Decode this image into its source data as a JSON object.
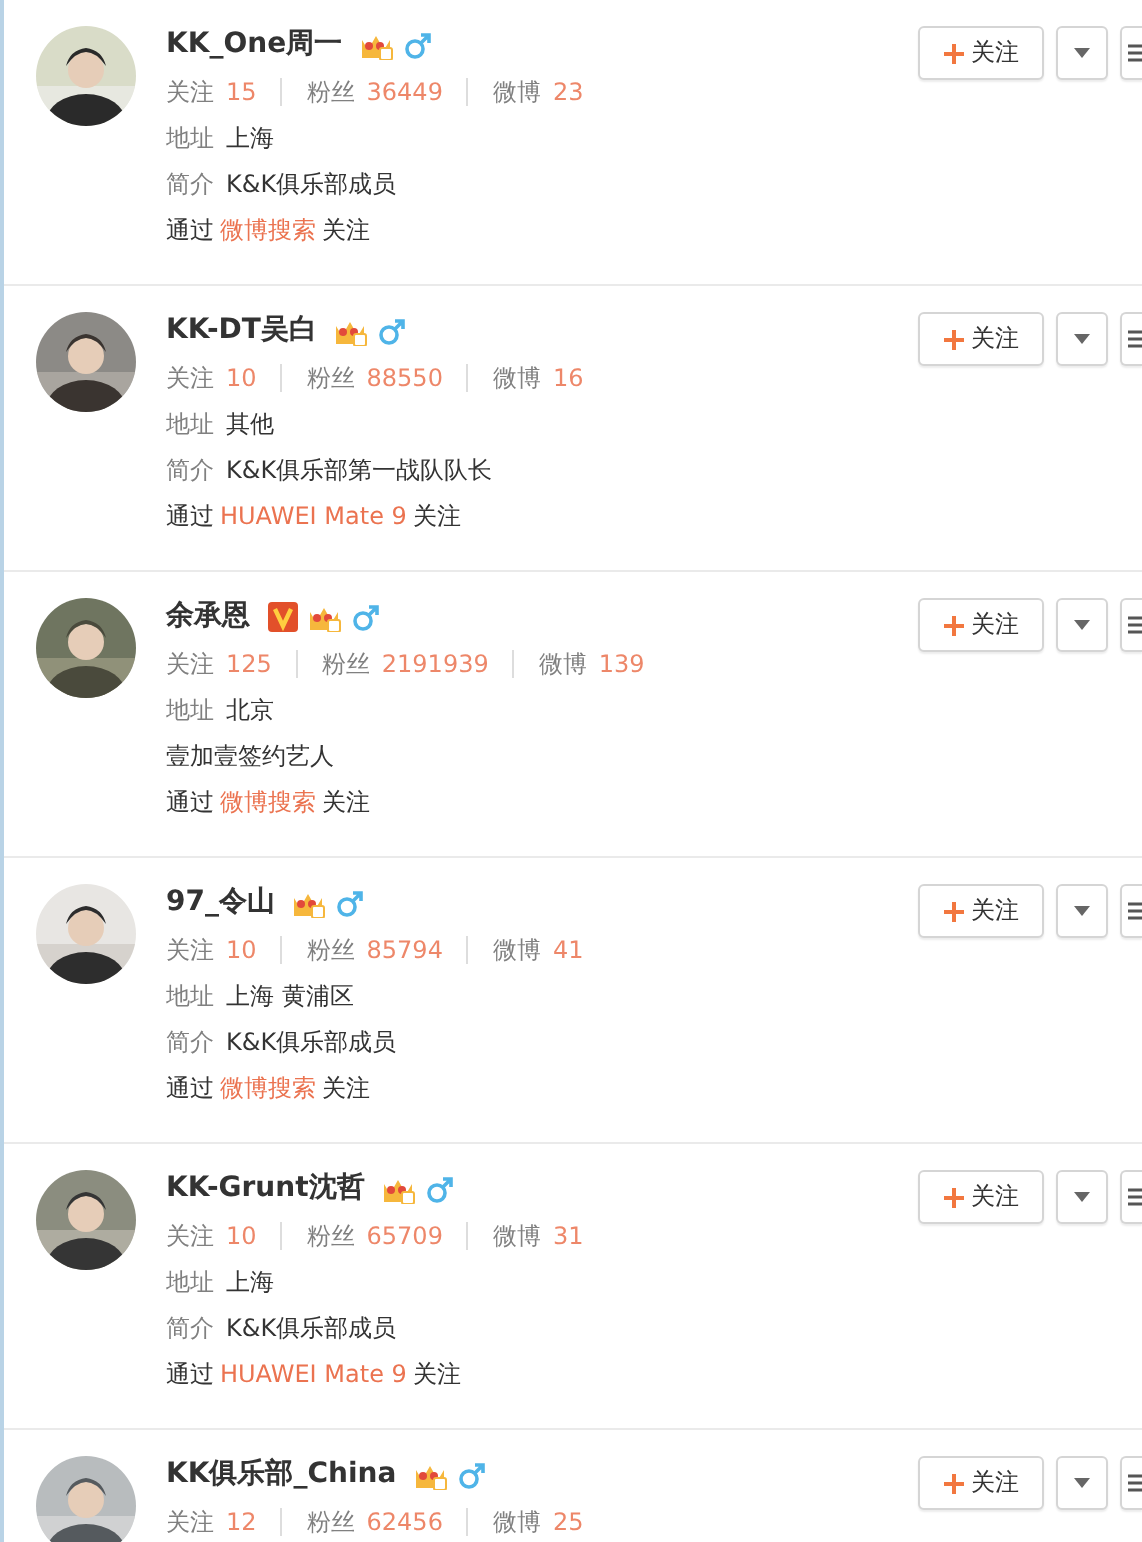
{
  "users": [
    {
      "name": "KK_One周一",
      "verified": false,
      "stats": [
        {
          "label": "关注",
          "value": "15"
        },
        {
          "label": "粉丝",
          "value": "36449"
        },
        {
          "label": "微博",
          "value": "23"
        }
      ],
      "details": [
        {
          "label": "地址",
          "text": "上海"
        },
        {
          "label": "简介",
          "text": "K&K俱乐部成员"
        }
      ],
      "source": {
        "prefix": "通过",
        "via": "微博搜索",
        "suffix": "关注"
      },
      "follow_label": "关注"
    },
    {
      "name": "KK-DT吴白",
      "verified": false,
      "stats": [
        {
          "label": "关注",
          "value": "10"
        },
        {
          "label": "粉丝",
          "value": "88550"
        },
        {
          "label": "微博",
          "value": "16"
        }
      ],
      "details": [
        {
          "label": "地址",
          "text": "其他"
        },
        {
          "label": "简介",
          "text": "K&K俱乐部第一战队队长"
        }
      ],
      "source": {
        "prefix": "通过",
        "via": "HUAWEI Mate 9",
        "suffix": "关注"
      },
      "follow_label": "关注"
    },
    {
      "name": "余承恩",
      "verified": true,
      "stats": [
        {
          "label": "关注",
          "value": "125"
        },
        {
          "label": "粉丝",
          "value": "2191939"
        },
        {
          "label": "微博",
          "value": "139"
        }
      ],
      "details": [
        {
          "label": "地址",
          "text": "北京"
        },
        {
          "text": "壹加壹签约艺人"
        }
      ],
      "source": {
        "prefix": "通过",
        "via": "微博搜索",
        "suffix": "关注"
      },
      "follow_label": "关注"
    },
    {
      "name": "97_令山",
      "verified": false,
      "stats": [
        {
          "label": "关注",
          "value": "10"
        },
        {
          "label": "粉丝",
          "value": "85794"
        },
        {
          "label": "微博",
          "value": "41"
        }
      ],
      "details": [
        {
          "label": "地址",
          "text": "上海 黄浦区"
        },
        {
          "label": "简介",
          "text": "K&K俱乐部成员"
        }
      ],
      "source": {
        "prefix": "通过",
        "via": "微博搜索",
        "suffix": "关注"
      },
      "follow_label": "关注"
    },
    {
      "name": "KK-Grunt沈哲",
      "verified": false,
      "stats": [
        {
          "label": "关注",
          "value": "10"
        },
        {
          "label": "粉丝",
          "value": "65709"
        },
        {
          "label": "微博",
          "value": "31"
        }
      ],
      "details": [
        {
          "label": "地址",
          "text": "上海"
        },
        {
          "label": "简介",
          "text": "K&K俱乐部成员"
        }
      ],
      "source": {
        "prefix": "通过",
        "via": "HUAWEI Mate 9",
        "suffix": "关注"
      },
      "follow_label": "关注"
    },
    {
      "name": "KK俱乐部_China",
      "verified": false,
      "stats": [
        {
          "label": "关注",
          "value": "12"
        },
        {
          "label": "粉丝",
          "value": "62456"
        },
        {
          "label": "微博",
          "value": "25"
        }
      ],
      "follow_label": "关注"
    }
  ]
}
